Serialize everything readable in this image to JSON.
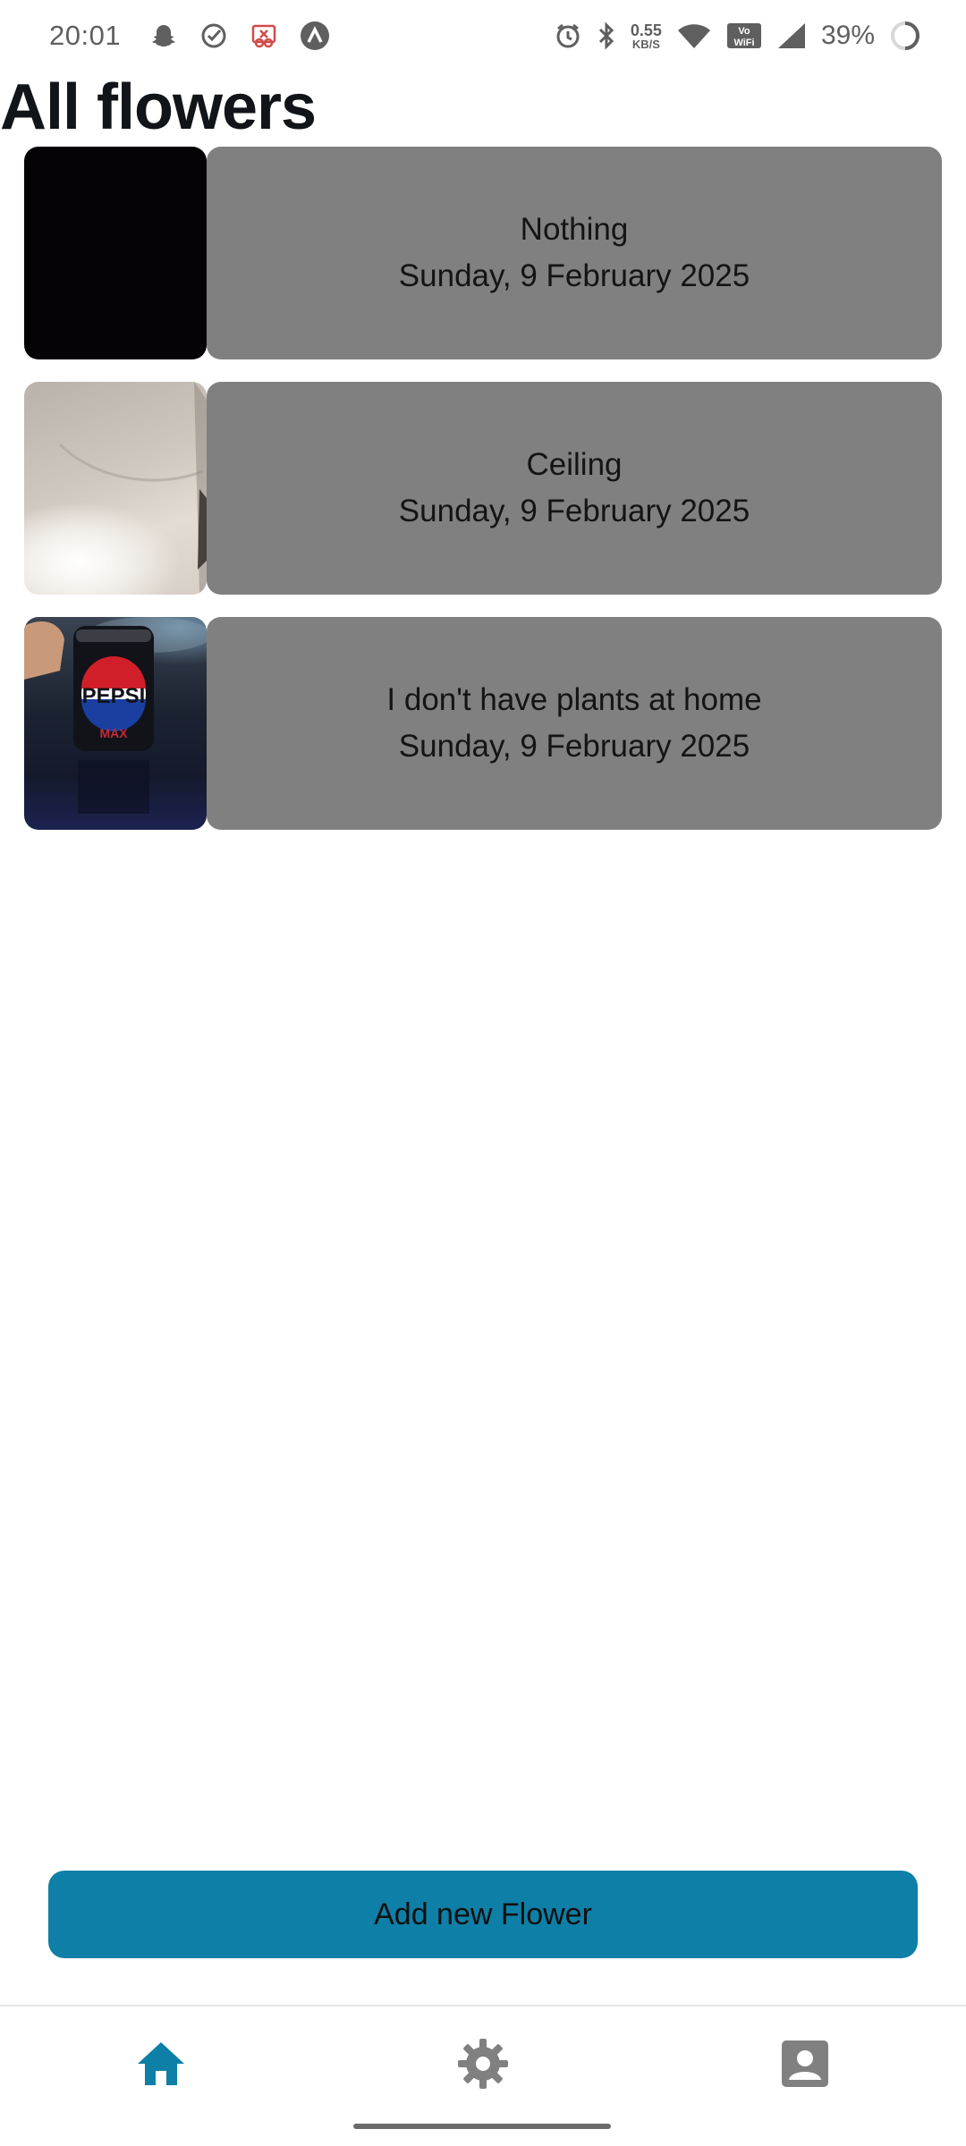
{
  "status_bar": {
    "time": "20:01",
    "speed_value": "0.55",
    "speed_unit": "KB/S",
    "battery": "39%",
    "left_icons": [
      "snapchat-icon",
      "check-circle-icon",
      "screen-record-icon",
      "arc-icon"
    ],
    "right_icons": [
      "alarm-icon",
      "bluetooth-icon",
      "wifi-icon",
      "vowifi-icon",
      "cell-signal-icon",
      "battery-ring-icon"
    ]
  },
  "page": {
    "title": "All flowers"
  },
  "flowers": [
    {
      "name": "Nothing",
      "date": "Sunday, 9 February 2025",
      "thumb": "dark"
    },
    {
      "name": "Ceiling",
      "date": "Sunday, 9 February 2025",
      "thumb": "ceiling"
    },
    {
      "name": "I don't have plants at home",
      "date": "Sunday, 9 February 2025",
      "thumb": "pepsi"
    }
  ],
  "pepsi_label": {
    "brand": "PEPSI",
    "variant": "MAX"
  },
  "actions": {
    "add_label": "Add new Flower"
  },
  "nav": {
    "items": [
      "home-icon",
      "settings-icon",
      "account-icon"
    ],
    "active": "home",
    "active_color": "#0e7fa6",
    "inactive_color": "#808080"
  },
  "colors": {
    "accent": "#0e7fa6",
    "card_bg": "#808080"
  }
}
